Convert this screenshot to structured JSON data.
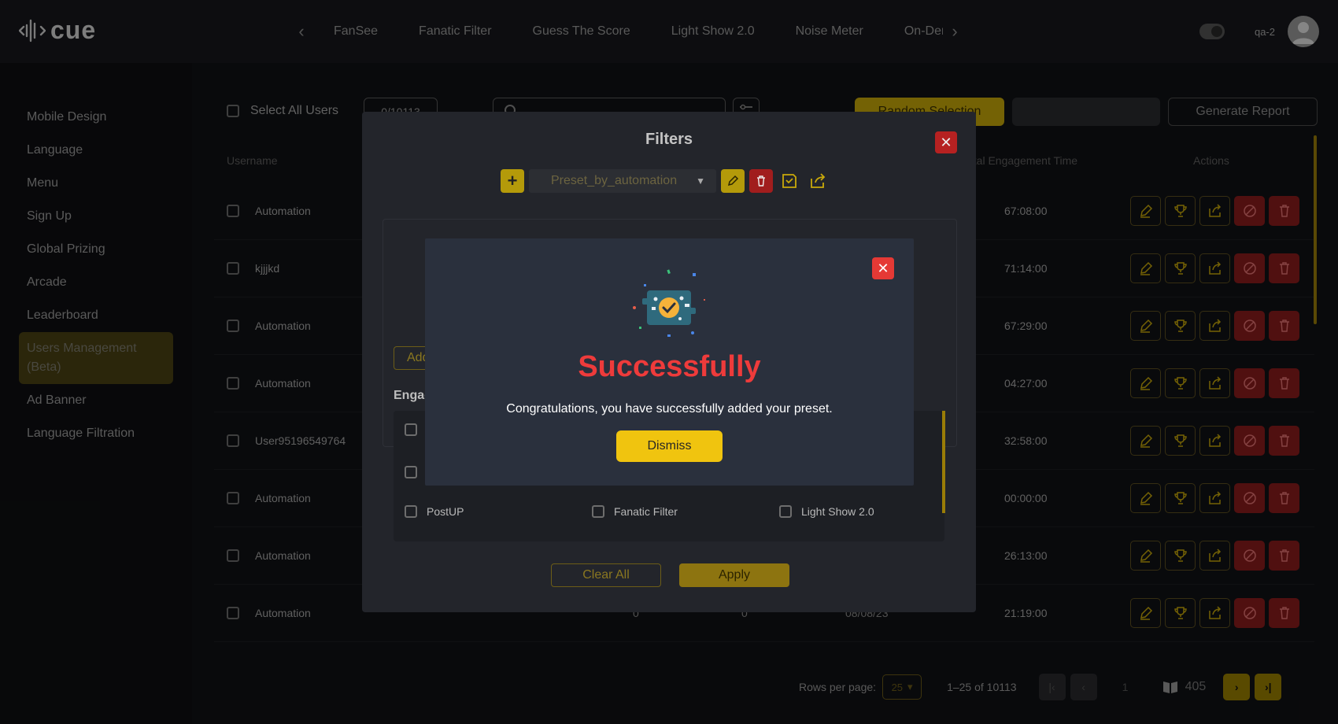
{
  "app": {
    "logo_text": "cue"
  },
  "header": {
    "tabs": [
      "FanSee",
      "Fanatic Filter",
      "Guess The Score",
      "Light Show 2.0",
      "Noise Meter",
      "On-Demand"
    ],
    "user_name": "qa-2"
  },
  "sidebar": {
    "items": [
      {
        "label": "Mobile Design"
      },
      {
        "label": "Language"
      },
      {
        "label": "Menu"
      },
      {
        "label": "Sign Up"
      },
      {
        "label": "Global Prizing"
      },
      {
        "label": "Arcade"
      },
      {
        "label": "Leaderboard"
      },
      {
        "label": "Users Management (Beta)"
      },
      {
        "label": "Ad Banner"
      },
      {
        "label": "Language Filtration"
      }
    ],
    "active_index": 7
  },
  "toolbar": {
    "select_all_label": "Select All Users",
    "selected_count": "0/10113",
    "random_selection_label": "Random Selection",
    "generate_report_label": "Generate Report"
  },
  "table": {
    "headers": {
      "username": "Username",
      "engagement_time": "Total Engagement Time",
      "actions": "Actions"
    },
    "rows": [
      {
        "username": "Automation",
        "time": "67:08:00"
      },
      {
        "username": "kjjjkd",
        "time": "71:14:00"
      },
      {
        "username": "Automation",
        "time": "67:29:00"
      },
      {
        "username": "Automation",
        "time": "04:27:00"
      },
      {
        "username": "User95196549764",
        "time": "32:58:00"
      },
      {
        "username": "Automation",
        "time": "00:00:00"
      },
      {
        "username": "Automation",
        "time": "26:13:00"
      },
      {
        "username": "Automation",
        "time": "21:19:00",
        "col1": "0",
        "col2": "0",
        "date": "08/08/23"
      }
    ]
  },
  "pagination": {
    "rows_per_page_label": "Rows per page:",
    "rows_per_page_value": "25",
    "range": "1–25 of 10113",
    "current_page": "1",
    "total_pages": "405"
  },
  "filters_modal": {
    "title": "Filters",
    "preset_name": "Preset_by_automation",
    "add_label": "Add",
    "engagement_title": "Engagement",
    "options": [
      {
        "label": "PostUP"
      },
      {
        "label": "Fanatic Filter"
      },
      {
        "label": "Light Show 2.0"
      }
    ],
    "clear_label": "Clear All",
    "apply_label": "Apply"
  },
  "success_modal": {
    "title": "Successfully",
    "message": "Congratulations, you have successfully added your preset.",
    "dismiss_label": "Dismiss"
  },
  "colors": {
    "accent": "#f0c40f",
    "danger": "#e53935",
    "title_red": "#ee3b3b"
  }
}
